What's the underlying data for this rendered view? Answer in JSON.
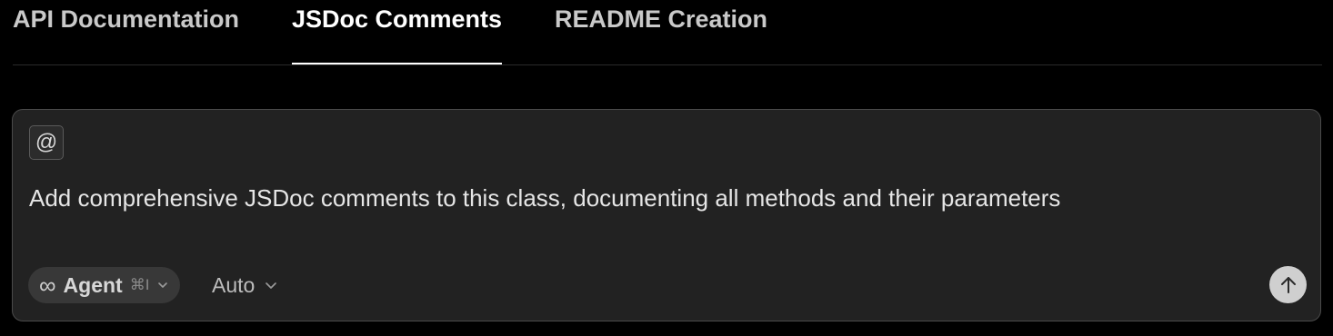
{
  "tabs": [
    {
      "label": "API Documentation",
      "active": false
    },
    {
      "label": "JSDoc Comments",
      "active": true
    },
    {
      "label": "README Creation",
      "active": false
    }
  ],
  "composer": {
    "mention_symbol": "@",
    "prompt": "Add comprehensive JSDoc comments to this class, documenting all methods and their parameters",
    "agent": {
      "icon": "infinity-icon",
      "label": "Agent",
      "shortcut": "⌘I"
    },
    "model": {
      "label": "Auto"
    },
    "send_icon": "arrow-up-icon"
  },
  "colors": {
    "background": "#000000",
    "composer_bg": "#222222",
    "send_button": "#cfcfcf",
    "active_tab_underline": "#ffffff"
  }
}
